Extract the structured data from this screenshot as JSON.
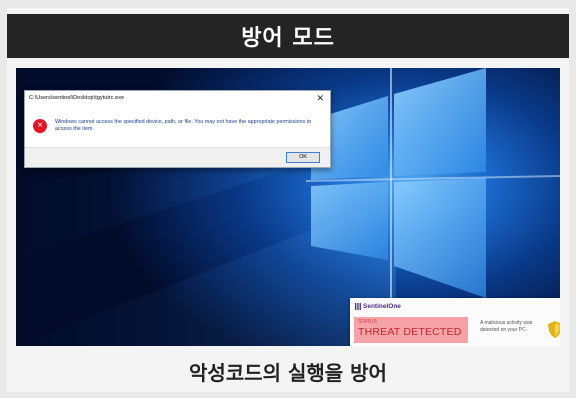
{
  "header": {
    "title": "방어 모드"
  },
  "dialog": {
    "title": "C:\\Users\\sentinel\\Desktop\\tgytutrc.exe",
    "close_icon": "close-icon",
    "error_icon": "error-icon",
    "error_glyph": "×",
    "close_glyph": "✕",
    "message": "Windows cannot access the specified device, path, or file. You may not have the appropriate permissions to access the item.",
    "ok_label": "OK"
  },
  "notification": {
    "brand": "SentinelOne",
    "status_label": "STATUS",
    "status_value": "THREAT DETECTED",
    "message": "A malicious activity was detected on your PC.",
    "close_glyph": "✕",
    "status_color": "#f5a3a7",
    "shield_icon": "shield-icon"
  },
  "caption": {
    "text": "악성코드의 실행을 방어"
  },
  "colors": {
    "header_bg": "#242424",
    "desktop_accent": "#1c6dd0",
    "error_red": "#e81123",
    "brand_purple": "#4b2b8c"
  }
}
